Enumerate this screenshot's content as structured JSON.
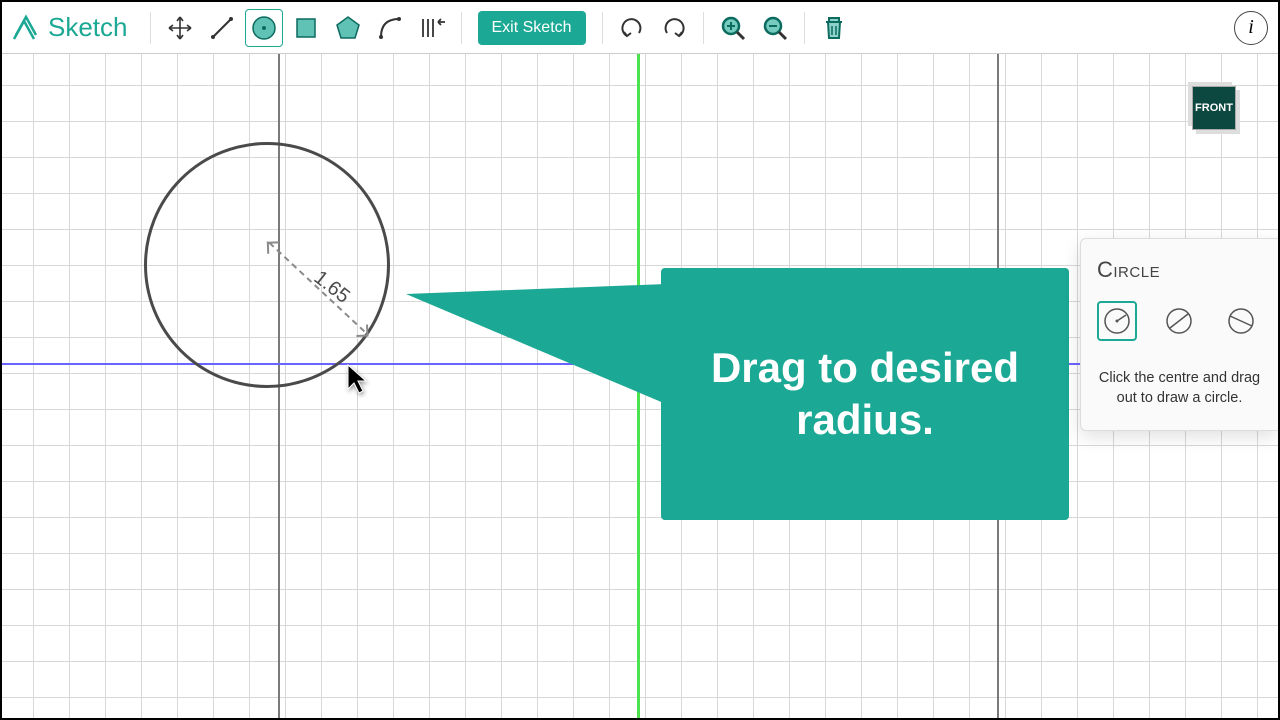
{
  "mode_label": "Sketch",
  "toolbar": {
    "exit_label": "Exit Sketch"
  },
  "canvas": {
    "radius_value": "1.65",
    "view_label": "FRONT"
  },
  "callout": {
    "text": "Drag to desired radius."
  },
  "panel": {
    "title": "Circle",
    "help": "Click the centre and drag out to draw a circle.",
    "options": [
      "center-radius",
      "2-point",
      "3-point"
    ]
  },
  "icons": {
    "move": "move",
    "line": "line",
    "circle": "circle",
    "rectangle": "rectangle",
    "polygon": "polygon",
    "arc": "arc",
    "dimension": "dimension",
    "undo": "undo",
    "redo": "redo",
    "zoom_in": "zoom-in",
    "zoom_out": "zoom-out",
    "trash": "trash",
    "info": "i"
  }
}
